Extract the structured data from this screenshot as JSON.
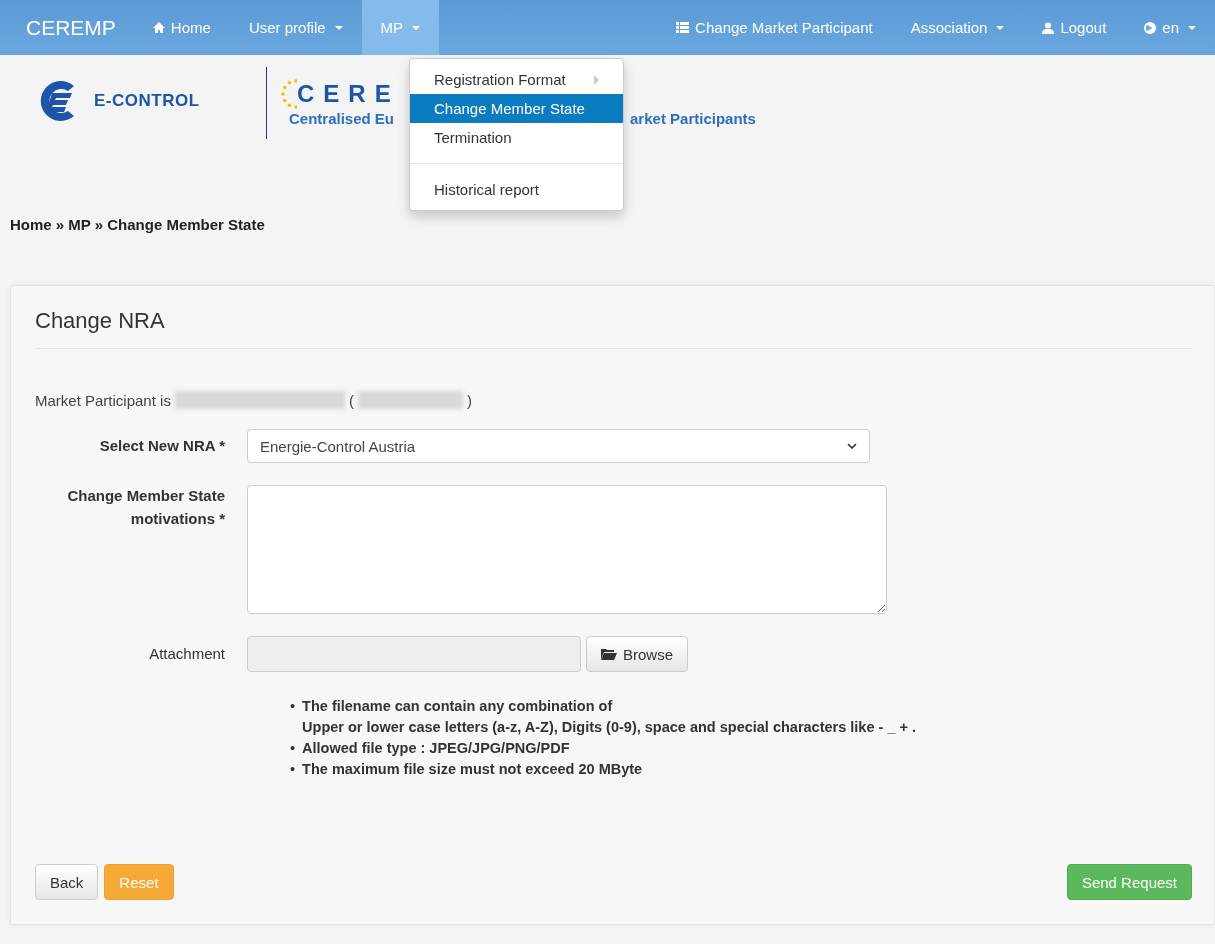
{
  "navbar": {
    "brand": "CEREMP",
    "items": [
      {
        "label": "Home",
        "dropdown": false,
        "selected": false
      },
      {
        "label": "User profile",
        "dropdown": true,
        "selected": false
      },
      {
        "label": "MP",
        "dropdown": true,
        "selected": true
      }
    ],
    "right_items": [
      {
        "label": "Change Market Participant",
        "dropdown": false,
        "selected": false
      },
      {
        "label": "Association",
        "dropdown": true,
        "selected": false
      },
      {
        "label": "Logout",
        "dropdown": false,
        "selected": false
      },
      {
        "label": "en",
        "dropdown": true,
        "selected": false
      }
    ]
  },
  "dropdown_menu": {
    "items": [
      {
        "kind": "item",
        "label": "Registration Format",
        "submenu": true,
        "selected": false
      },
      {
        "kind": "item",
        "label": "Change Member State",
        "submenu": false,
        "selected": true
      },
      {
        "kind": "item",
        "label": "Termination",
        "submenu": false,
        "selected": false
      },
      {
        "kind": "divider"
      },
      {
        "kind": "item",
        "label": "Historical report",
        "submenu": false,
        "selected": false
      }
    ]
  },
  "header": {
    "econtrol_logo": "E-CONTROL",
    "ceremp_logo": {
      "letters": "CERE",
      "subtitle_left": "Centralised Eu",
      "subtitle_right": "arket Participants"
    }
  },
  "breadcrumb": [
    "Home",
    "MP",
    "Change Member State"
  ],
  "breadcrumb_separator": "»",
  "panel": {
    "title": "Change NRA",
    "participant": {
      "label": "Market Participant is",
      "open_paren": "(",
      "close_paren": ")"
    },
    "fields": [
      {
        "kind": "select",
        "label": "Select New NRA *",
        "value": "Energie-Control Austria"
      },
      {
        "kind": "textarea",
        "label": "Change Member State motivations *"
      },
      {
        "kind": "file",
        "label": "Attachment",
        "button": "Browse"
      }
    ],
    "note_bullet": "•",
    "notes": [
      "The filename can contain any combination of\nUpper or lower case letters (a-z, A-Z), Digits (0-9), space and special characters like - _ + .",
      "Allowed file type : JPEG/JPG/PNG/PDF",
      "The maximum file size must not exceed 20 MByte"
    ],
    "buttons": [
      {
        "label": "Back",
        "kind": "default"
      },
      {
        "label": "Reset",
        "kind": "warning"
      },
      {
        "label": "Send Request",
        "kind": "success"
      }
    ]
  }
}
